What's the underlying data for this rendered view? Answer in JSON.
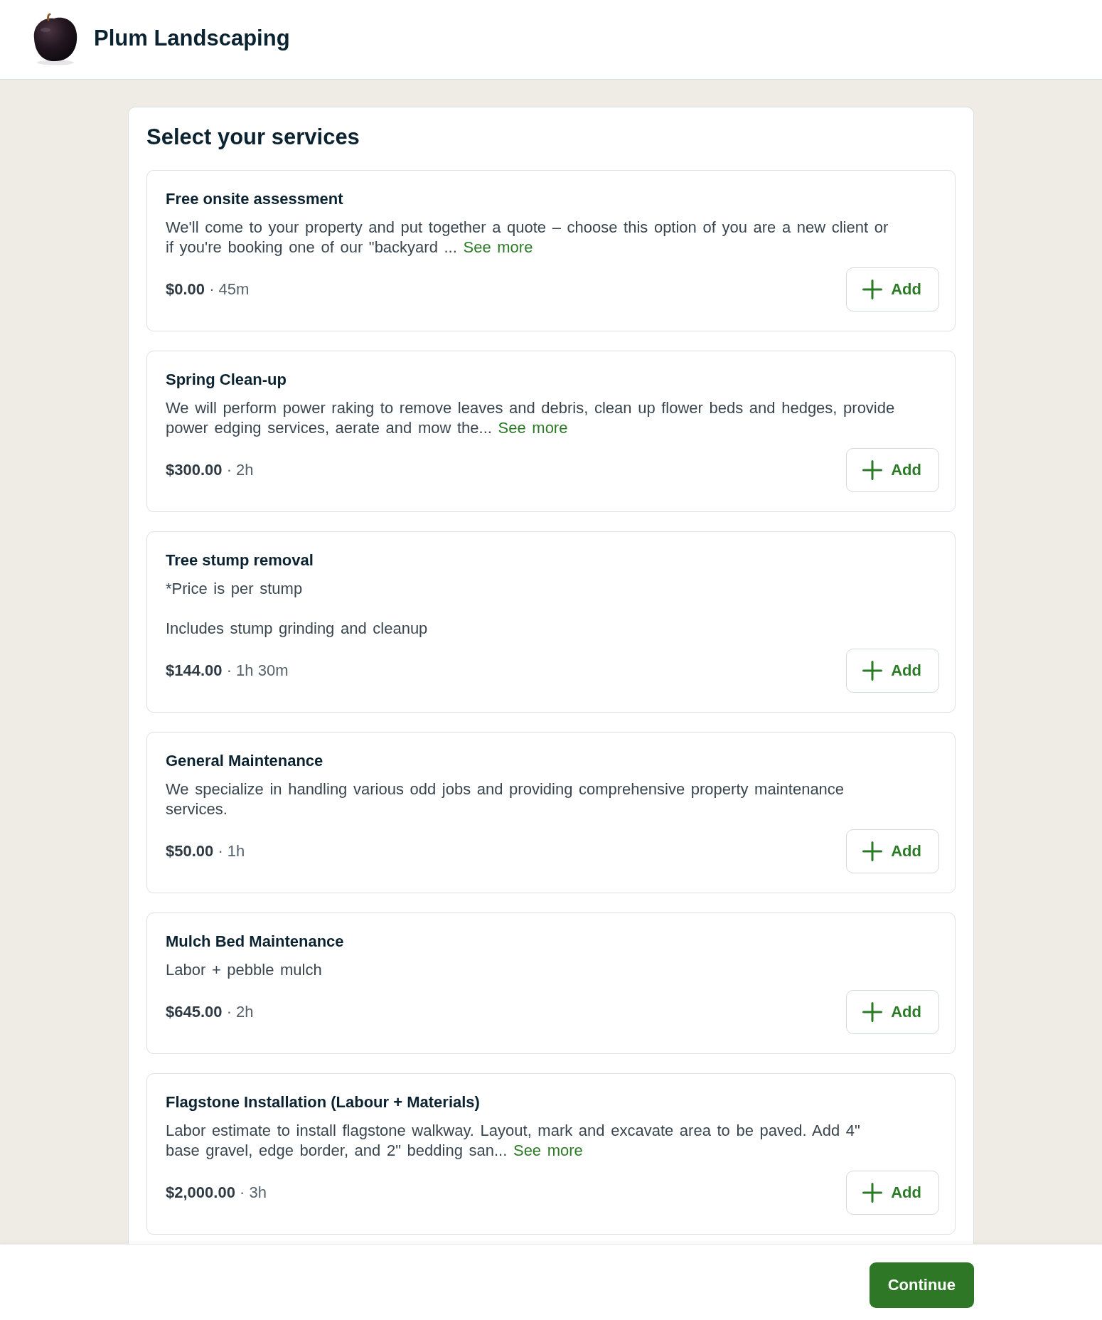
{
  "header": {
    "business_name": "Plum Landscaping"
  },
  "page": {
    "heading": "Select your services"
  },
  "services": [
    {
      "name": "Free onsite assessment",
      "description": [
        "We'll come to your property and put together a quote – choose this option of you are a new client or if you're booking one of our \"backyard ..."
      ],
      "see_more": "See more",
      "price_line": "**$0.00** · 45m",
      "add_label": "Add"
    },
    {
      "name": "Spring Clean-up",
      "description": [
        "We will perform power raking to remove leaves and debris, clean up flower beds and hedges, provide power edging services, aerate and mow the..."
      ],
      "see_more": "See more",
      "price_line": "**$300.00** · 2h",
      "add_label": "Add"
    },
    {
      "name": "Tree stump removal",
      "description": [
        "*Price is per stump",
        "Includes stump grinding and cleanup"
      ],
      "price_line": "**$144.00** · 1h 30m",
      "add_label": "Add"
    },
    {
      "name": "General Maintenance",
      "description": [
        "We specialize in handling various odd jobs and providing comprehensive property maintenance services."
      ],
      "price_line": "**$50.00** · 1h",
      "add_label": "Add"
    },
    {
      "name": "Mulch Bed Maintenance",
      "description": [
        "Labor + pebble mulch"
      ],
      "price_line": "**$645.00** · 2h",
      "add_label": "Add"
    },
    {
      "name": "Flagstone Installation (Labour + Materials)",
      "description": [
        "Labor estimate to install flagstone walkway. Layout, mark and excavate area to be paved. Add 4\" base gravel, edge border, and 2\" bedding san..."
      ],
      "see_more": "See more",
      "price_line": "**$2,000.00** · 3h",
      "add_label": "Add"
    }
  ],
  "footer": {
    "continue_label": "Continue"
  }
}
